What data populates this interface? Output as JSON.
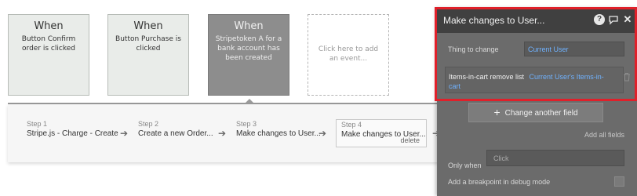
{
  "events": [
    {
      "when": "When",
      "desc": "Button Confirm order is clicked"
    },
    {
      "when": "When",
      "desc": "Button Purchase is clicked"
    },
    {
      "when": "When",
      "desc": "Stripetoken A for a bank account has been created"
    },
    {
      "desc": "Click here to add an event..."
    }
  ],
  "steps": [
    {
      "num": "Step 1",
      "name": "Stripe.js - Charge - Create"
    },
    {
      "num": "Step 2",
      "name": "Create a new Order..."
    },
    {
      "num": "Step 3",
      "name": "Make changes to User..."
    },
    {
      "num": "Step 4",
      "name": "Make changes to User...",
      "action": "delete"
    }
  ],
  "panel": {
    "title": "Make changes to User...",
    "thing_to_change_label": "Thing to change",
    "thing_to_change_value": "Current User",
    "field_row": {
      "field": "Items-in-cart remove list",
      "value_line1": "Current User's Items-in-",
      "value_line2": "cart"
    },
    "change_another": "Change another field",
    "add_all": "Add all fields",
    "only_when_label": "Only when",
    "only_when_placeholder": "Click",
    "breakpoint_label": "Add a breakpoint in debug mode"
  },
  "colors": {
    "highlight": "#e0202a",
    "link": "#6fb2ff",
    "panel_bg": "#6b6b6b",
    "header_bg": "#404040"
  }
}
